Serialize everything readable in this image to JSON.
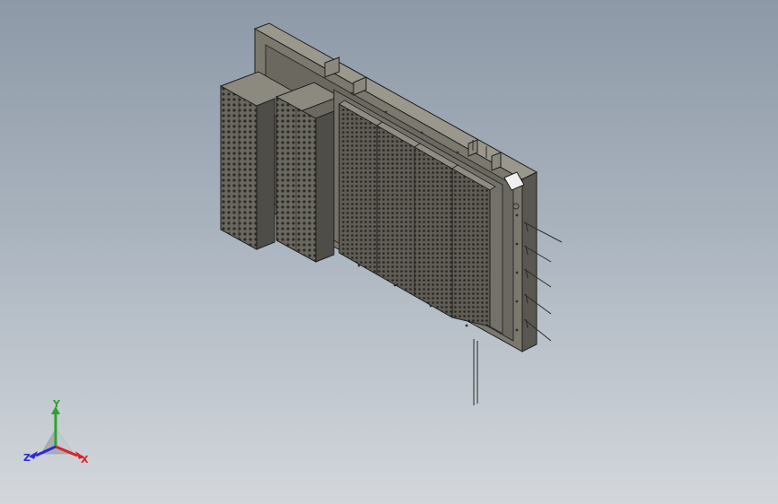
{
  "viewport": {
    "background_top": "#8d99a7",
    "background_bottom": "#d3d7dc"
  },
  "model": {
    "frame_color": "#6f6c62",
    "cell_color": "#5a5750",
    "hole_color": "#2b2a26",
    "edge_color": "#1f1f1f"
  },
  "triad": {
    "x_label": "X",
    "y_label": "Y",
    "z_label": "Z",
    "x_color": "#d8242a",
    "y_color": "#2aa52a",
    "z_color": "#2a2ad8"
  }
}
